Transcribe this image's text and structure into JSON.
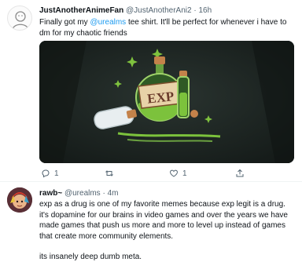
{
  "tweet1": {
    "name": "JustAnotherAnimeFan",
    "handle": "@JustAnotherAni2",
    "separator": "·",
    "time": "16h",
    "text_before": "Finally got my ",
    "mention": "@urealms",
    "text_after": " tee shirt. It'll be perfect for whenever i have to dm for my chaotic friends",
    "image_label": "EXP",
    "reply_count": "1",
    "retweet_count": "",
    "like_count": "1"
  },
  "tweet2": {
    "name": "rawb~",
    "handle": "@urealms",
    "separator": "·",
    "time": "4m",
    "para1": "exp as a drug is one of my favorite memes because exp legit is a drug. it's dopamine for our brains in video games and over the years we have made games that push us more and more to level up instead of games that create more community elements.",
    "para2": "its insanely deep dumb meta."
  },
  "colors": {
    "accent": "#1d9bf0",
    "secondary": "#536471",
    "potion_green": "#78c23a"
  },
  "icons": [
    "reply-icon",
    "retweet-icon",
    "like-icon",
    "share-icon"
  ]
}
